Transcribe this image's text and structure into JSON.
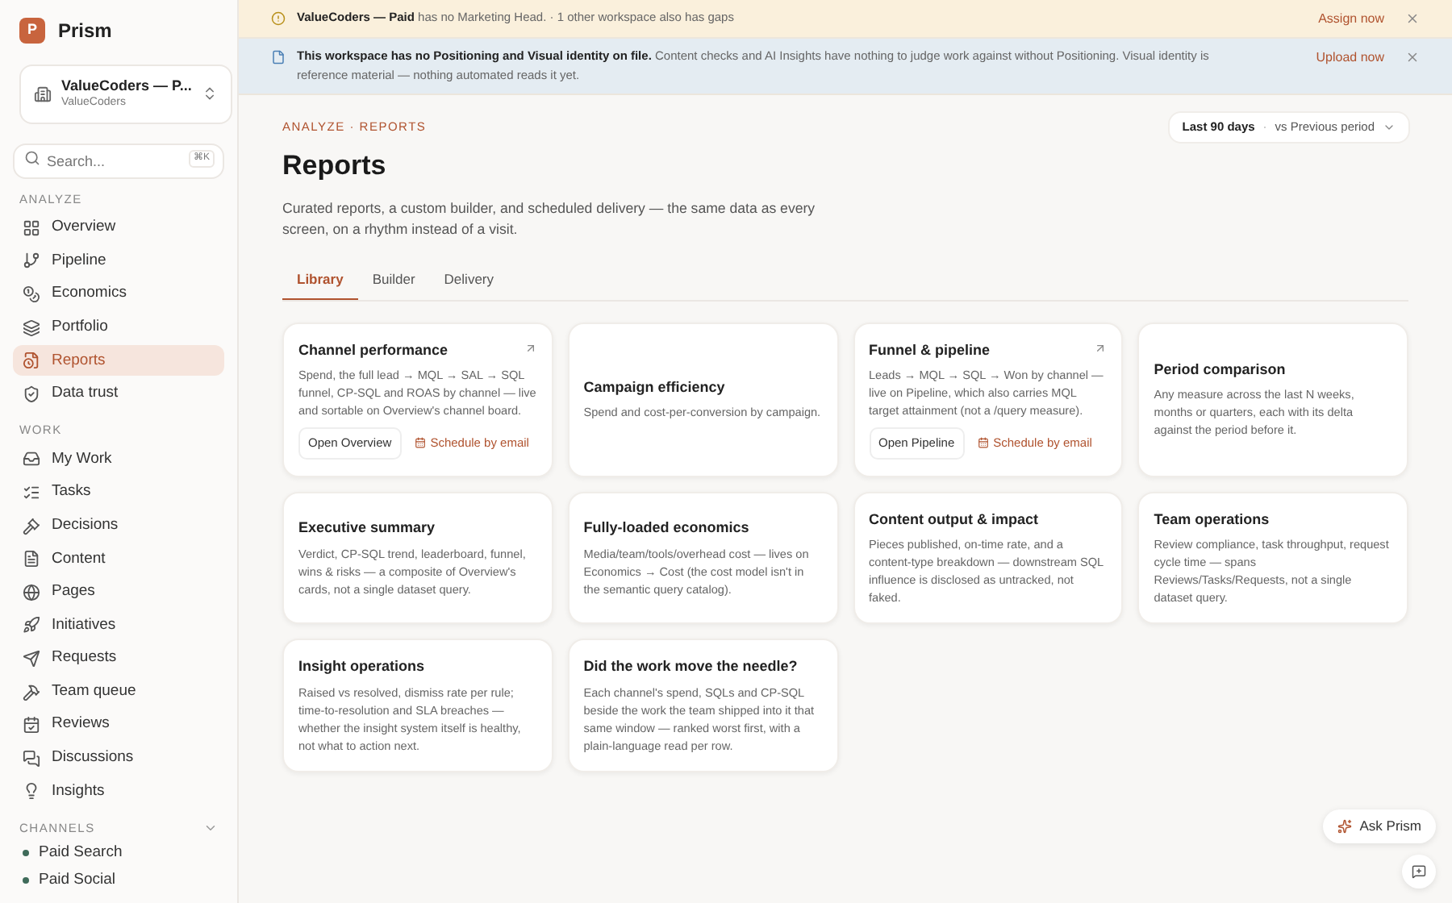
{
  "app": {
    "logo_letter": "P",
    "name": "Prism"
  },
  "workspace": {
    "name": "ValueCoders — P...",
    "sub": "ValueCoders"
  },
  "search": {
    "placeholder": "Search...",
    "shortcut": "⌘K"
  },
  "sidebar": {
    "sections": [
      {
        "title": "ANALYZE",
        "items": [
          {
            "label": "Overview",
            "selected": false
          },
          {
            "label": "Pipeline",
            "selected": false
          },
          {
            "label": "Economics",
            "selected": false
          },
          {
            "label": "Portfolio",
            "selected": false
          },
          {
            "label": "Reports",
            "selected": true
          },
          {
            "label": "Data trust",
            "selected": false
          }
        ]
      },
      {
        "title": "WORK",
        "items": [
          {
            "label": "My Work",
            "selected": false
          },
          {
            "label": "Tasks",
            "selected": false
          },
          {
            "label": "Decisions",
            "selected": false
          },
          {
            "label": "Content",
            "selected": false
          },
          {
            "label": "Pages",
            "selected": false
          },
          {
            "label": "Initiatives",
            "selected": false
          },
          {
            "label": "Requests",
            "selected": false
          },
          {
            "label": "Team queue",
            "selected": false
          },
          {
            "label": "Reviews",
            "selected": false
          },
          {
            "label": "Discussions",
            "selected": false
          },
          {
            "label": "Insights",
            "selected": false
          }
        ]
      },
      {
        "title": "CHANNELS",
        "channels": [
          {
            "label": "Paid Search"
          },
          {
            "label": "Paid Social"
          }
        ]
      }
    ]
  },
  "banners": [
    {
      "kind": "warning",
      "text": "**ValueCoders — Paid** has no Marketing Head. · 1 other workspace also has gaps",
      "action": "Assign now"
    },
    {
      "kind": "info",
      "text": "**This workspace has no Positioning and Visual identity on file.** Content checks and AI Insights have nothing to judge work against without Positioning. Visual identity is reference material — nothing automated reads it yet.",
      "action": "Upload now"
    }
  ],
  "breadcrumb": "ANALYZE · REPORTS",
  "title": "Reports",
  "description": "Curated reports, a custom builder, and scheduled delivery — the same data as every screen, on a rhythm instead of a visit.",
  "period": {
    "range": "Last 90 days",
    "separator": "·",
    "compare": "vs Previous period"
  },
  "tabs": [
    {
      "label": "Library",
      "selected": true
    },
    {
      "label": "Builder",
      "selected": false
    },
    {
      "label": "Delivery",
      "selected": false
    }
  ],
  "cards": [
    {
      "title": "Channel performance",
      "external": true,
      "text": "Spend, the full lead → MQL → SAL → SQL funnel, CP-SQL and ROAS by channel — live and sortable on Overview's channel board.",
      "open": "Open Overview",
      "schedule": "Schedule by email"
    },
    {
      "title": "Campaign efficiency",
      "external": false,
      "text": "Spend and cost-per-conversion by campaign."
    },
    {
      "title": "Funnel & pipeline",
      "external": true,
      "text": "Leads → MQL → SQL → Won by channel — live on Pipeline, which also carries MQL target attainment (not a /query measure).",
      "open": "Open Pipeline",
      "schedule": "Schedule by email"
    },
    {
      "title": "Period comparison",
      "external": false,
      "text": "Any measure across the last N weeks, months or quarters, each with its delta against the period before it."
    },
    {
      "title": "Executive summary",
      "external": false,
      "text": "Verdict, CP-SQL trend, leaderboard, funnel, wins & risks — a composite of Overview's cards, not a single dataset query."
    },
    {
      "title": "Fully-loaded economics",
      "external": false,
      "text": "Media/team/tools/overhead cost — lives on Economics → Cost (the cost model isn't in the semantic query catalog)."
    },
    {
      "title": "Content output & impact",
      "external": false,
      "text": "Pieces published, on-time rate, and a content-type breakdown — downstream SQL influence is disclosed as untracked, not faked."
    },
    {
      "title": "Team operations",
      "external": false,
      "text": "Review compliance, task throughput, request cycle time — spans Reviews/Tasks/Requests, not a single dataset query."
    },
    {
      "title": "Insight operations",
      "external": false,
      "text": "Raised vs resolved, dismiss rate per rule; time-to-resolution and SLA breaches — whether the insight system itself is healthy, not what to action next."
    },
    {
      "title": "Did the work move the needle?",
      "external": false,
      "text": "Each channel's spend, SQLs and CP-SQL beside the work the team shipped into it that same window — ranked worst first, with a plain-language read per row."
    }
  ],
  "ask_button": "Ask Prism"
}
